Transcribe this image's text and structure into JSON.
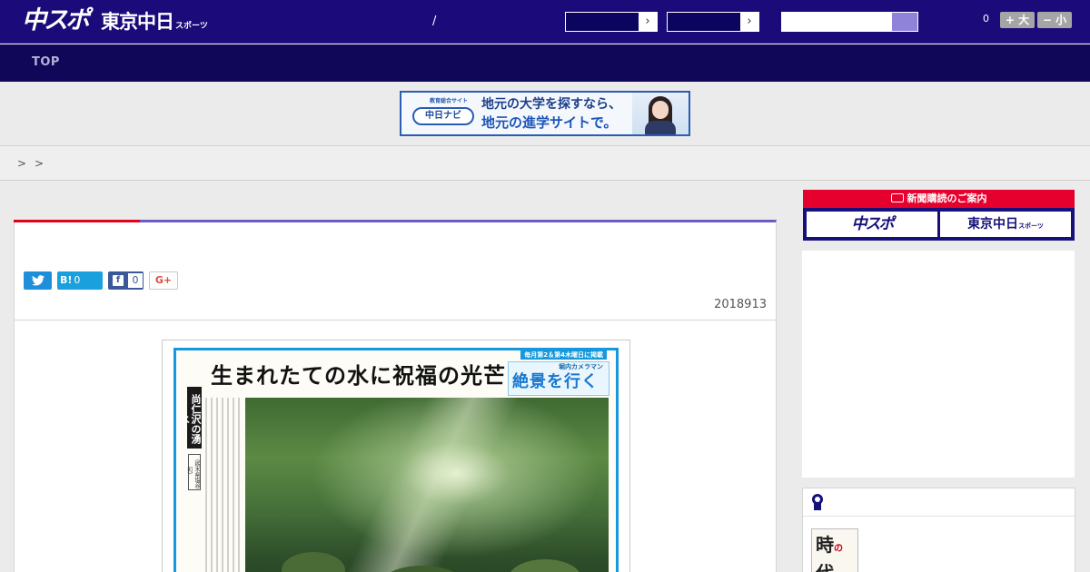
{
  "header": {
    "logo_chuspo": "中スポ",
    "logo_tokyo": "東京中日",
    "logo_tokyo_small": "スポーツ",
    "separator": "/",
    "jump_arrow": "›",
    "search_placeholder": "",
    "font_count": "0",
    "font_larger": "+ 大",
    "font_smaller": "− 小"
  },
  "nav": {
    "top": "TOP"
  },
  "banner": {
    "badge_top": "教育総合サイト",
    "badge_name": "中日ナビ",
    "line1": "地元の大学を探すなら、",
    "line2": "地元の進学サイトで。"
  },
  "breadcrumb": [
    ">",
    ">"
  ],
  "article": {
    "share": {
      "twitter_icon": "twitter-bird",
      "hatena_label": "B!",
      "hatena_count": "0",
      "facebook_label": "f",
      "facebook_count": "0",
      "gplus_label": "G+"
    },
    "date": "2018913",
    "newspaper": {
      "tagline": "毎月第2＆第4木曜日に掲載",
      "headline": "生まれたての水に祝福の光芒",
      "column_logo_sub": "堀内カメラマン",
      "column_logo": "絶景を行く",
      "place": "尚仁沢の湧水",
      "place_sub": "（栃木県塩谷町）"
    }
  },
  "sidebar": {
    "subscription_title": "新聞購読のご案内",
    "subscribe_chuspo": "中スポ",
    "subscribe_tokyo": "東京中日",
    "subscribe_tokyo_small": "スポーツ",
    "thumb_text_a": "時",
    "thumb_text_red": "の",
    "thumb_text_b": "代"
  },
  "colors": {
    "header": "#1b0a7a",
    "nav": "#100758",
    "accent_red": "#e3001b",
    "accent_purple": "#6b5cc4"
  }
}
